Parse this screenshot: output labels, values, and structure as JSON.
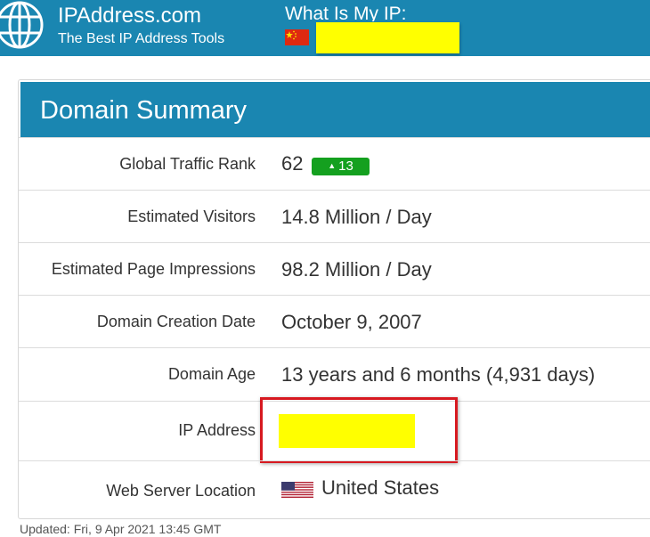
{
  "header": {
    "site_name": "IPAddress.com",
    "tagline": "The Best IP Address Tools",
    "my_ip_title": "What Is My IP:",
    "my_ip_flag": "china-flag",
    "my_ip_value": "",
    "background_color": "#1a86b1"
  },
  "summary": {
    "title": "Domain Summary",
    "rows": [
      {
        "label": "Global Traffic Rank",
        "value": "62",
        "badge": "13",
        "badge_icon": "up-arrow-icon",
        "badge_color": "#14a01f"
      },
      {
        "label": "Estimated Visitors",
        "value": "14.8 Million / Day"
      },
      {
        "label": "Estimated Page Impressions",
        "value": "98.2 Million / Day"
      },
      {
        "label": "Domain Creation Date",
        "value": "October 9, 2007"
      },
      {
        "label": "Domain Age",
        "value": "13 years and 6 months (4,931 days)"
      },
      {
        "label": "IP Address",
        "value": "",
        "highlight_color": "#ffff00",
        "outline_color": "#d71920"
      },
      {
        "label": "Web Server Location",
        "value": "United States",
        "flag": "us-flag"
      }
    ]
  },
  "footer": {
    "updated_text": "Updated: Fri, 9 Apr 2021 13:45 GMT"
  }
}
